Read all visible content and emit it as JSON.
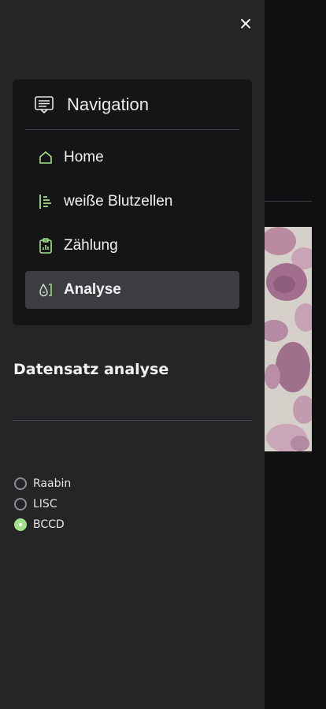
{
  "sidebar": {
    "close_label": "×",
    "navigation": {
      "title": "Navigation",
      "header_icon": "navigation-list-icon",
      "items": [
        {
          "label": "Home",
          "icon": "home-icon",
          "active": false
        },
        {
          "label": "weiße Blutzellen",
          "icon": "list-tree-icon",
          "active": false
        },
        {
          "label": "Zählung",
          "icon": "clipboard-chart-icon",
          "active": false
        },
        {
          "label": "Analyse",
          "icon": "drop-analysis-icon",
          "active": true
        }
      ]
    },
    "section_title": "Datensatz analyse",
    "dataset_options": [
      {
        "label": "Raabin",
        "checked": false
      },
      {
        "label": "LISC",
        "checked": false
      },
      {
        "label": "BCCD",
        "checked": true
      }
    ]
  },
  "colors": {
    "accent": "#a2e28b",
    "sidebar_bg": "#252527",
    "card_bg": "#151517",
    "active_bg": "#3c3d40"
  }
}
